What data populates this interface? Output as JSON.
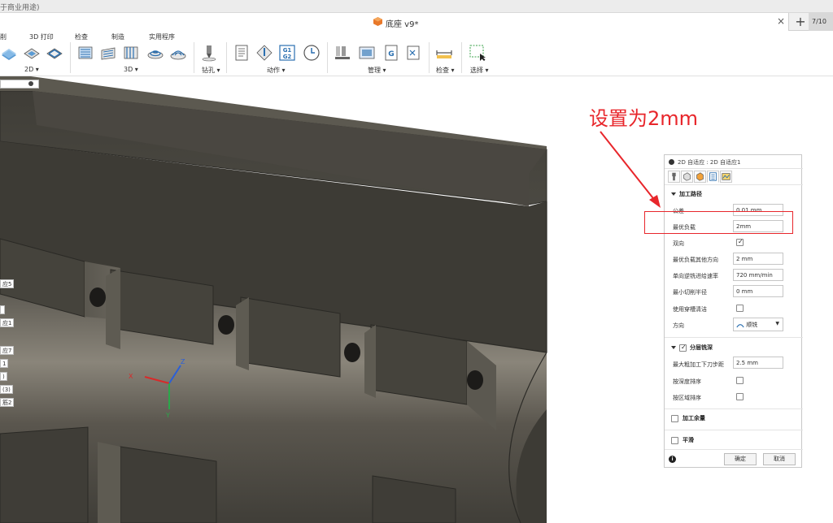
{
  "titlebar": {
    "text": "于商业用途)"
  },
  "tabbar": {
    "doc_title": "底座 v9*",
    "close": "×",
    "add": "+",
    "extra": "7/10"
  },
  "toolbar": {
    "categories": {
      "left_cut": "削",
      "print3d": "3D 打印",
      "inspect": "检查",
      "make": "制造",
      "utility": "实用程序"
    },
    "groups": {
      "g2d": "2D ▾",
      "g3d": "3D ▾",
      "drill": "钻孔 ▾",
      "actions": "动作 ▾",
      "manage": "管理 ▾",
      "check": "检查 ▾",
      "select": "选择 ▾"
    },
    "g1g2_top": "G1",
    "g1g2_bot": "G2",
    "accent": "#2a6fb0"
  },
  "browser": {
    "chips": [
      "应5",
      "",
      "应1",
      "应7",
      "1",
      ")",
      "(3)",
      "筋2"
    ]
  },
  "annotation": {
    "text": "设置为2mm",
    "color": "#e8262b"
  },
  "panel": {
    "title": "2D 自适应 : 2D 自适应1",
    "section_path": "加工路径",
    "rows": {
      "tolerance": {
        "label": "公差",
        "value": "0.01 mm"
      },
      "optimal_load": {
        "label": "最优负载",
        "value": "2mm"
      },
      "both_ways": {
        "label": "双向"
      },
      "optimal_load_other": {
        "label": "最优负载其他方向",
        "value": "2 mm"
      },
      "oneway_feed": {
        "label": "单向逆铣进给速率",
        "value": "720 mm/min"
      },
      "min_cut_radius": {
        "label": "最小切削半径",
        "value": "0 mm"
      },
      "use_slot_clear": {
        "label": "使用穿槽清洁"
      },
      "direction": {
        "label": "方向",
        "value": "顺铣"
      }
    },
    "section_layers": "分层铣深",
    "layer_rows": {
      "max_stepdown": {
        "label": "最大粗加工下刀步距",
        "value": "2.5 mm"
      },
      "order_by_depth": {
        "label": "按深度排序"
      },
      "order_by_area": {
        "label": "按区域排序"
      }
    },
    "section_stock": "加工余量",
    "section_smooth": "平滑",
    "ok": "确定",
    "cancel": "取消",
    "info": "i"
  },
  "axes": {
    "x": "X",
    "y": "Y",
    "z": "Z"
  }
}
